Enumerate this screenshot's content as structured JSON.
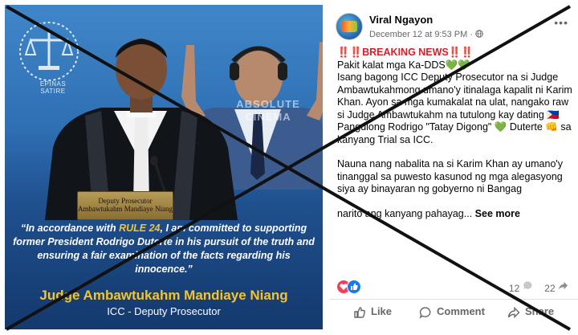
{
  "image": {
    "logo_text": "EPINAS\nSATIRE",
    "watermark": "ABSOLUTE\nCINEMA",
    "nameplate": {
      "line1": "Deputy Prosecutor",
      "line2": "Ambawtukahm Mandiaye Niang"
    },
    "quote": {
      "part1": "“In accordance with ",
      "highlight": "RULE 24",
      "part2": ", I am committed to supporting former President Rodrigo Duterte in his pursuit of the truth and ensuring a fair examination of the facts regarding his innocence.”"
    },
    "name": "Judge Ambawtukahm Mandiaye Niang",
    "title": "ICC - Deputy Prosecutor"
  },
  "post": {
    "page_name": "Viral Ngayon",
    "timestamp": "December 12 at 9:53 PM · ",
    "breaking": "‼️‼️BREAKING NEWS‼️‼️",
    "lines": [
      "Pakit kalat mga Ka-DDS💚💚",
      "Isang bagong ICC Deputy Prosecutor na si Judge Ambawtukahmong umano'y itinalaga kapalit ni Karim Khan. Ayon sa mga kumakalat na ulat, nangako raw si Judge Ambawtukahm na tutulong kay dating 🇵🇭 Pangulong Rodrigo \"Tatay Digong\" 💚 Duterte 👊 sa kanyang Trial sa ICC.",
      "Nauna nang nabalita na si Karim Khan ay umano'y tinanggal sa puwesto kasunod ng mga alegasyong siya ay binayaran ng gobyerno ni Bangag",
      "narito ang kanyang pahayag..."
    ],
    "see_more": "See more",
    "comments_count": "12",
    "shares_count": "22",
    "actions": {
      "like": "Like",
      "comment": "Comment",
      "share": "Share"
    },
    "colors": {
      "like_blue": "#1877f2",
      "love_red": "#f33e58",
      "text_grey": "#65676b"
    }
  }
}
